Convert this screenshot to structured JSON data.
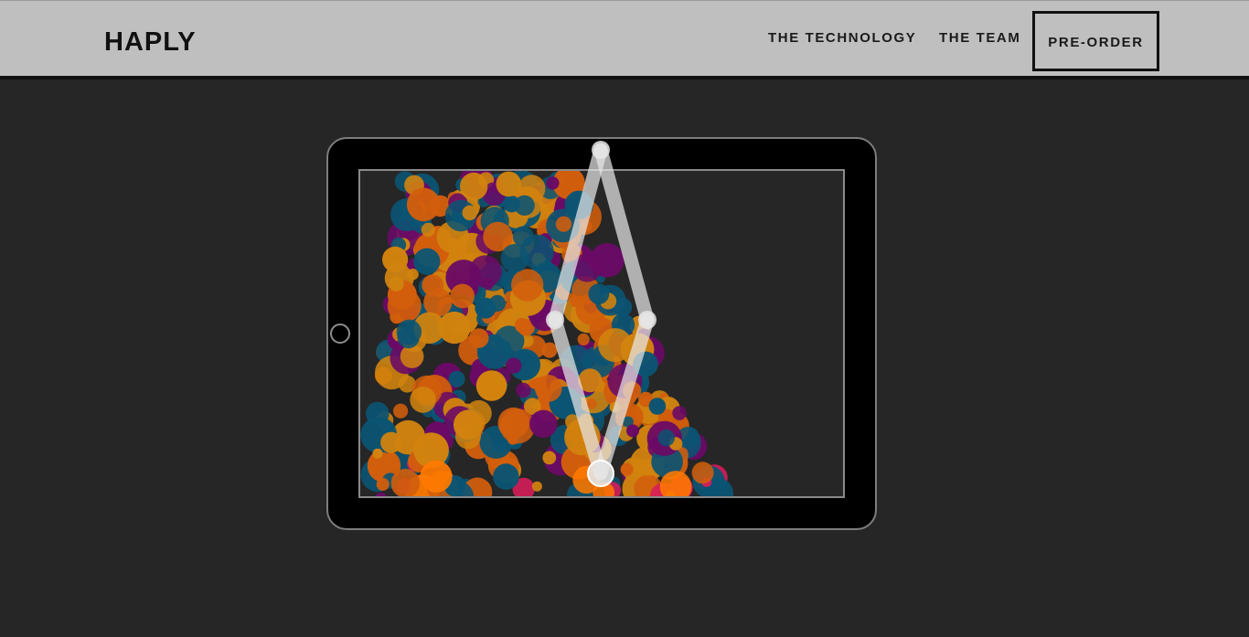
{
  "header": {
    "logo": "HAPLY",
    "nav": {
      "technology": "THE TECHNOLOGY",
      "team": "THE TEAM",
      "preorder": "PRE-ORDER"
    }
  },
  "demo": {
    "device": "tablet",
    "content": "haptic-particle-simulation",
    "particle_colors": [
      "#0b5473",
      "#6a0a66",
      "#d1830e",
      "#d25e0c",
      "#ff7a00",
      "#d81e5b"
    ],
    "linkage_color": "#e6e6e6"
  },
  "icons": {
    "home_button": "home-button-icon"
  }
}
